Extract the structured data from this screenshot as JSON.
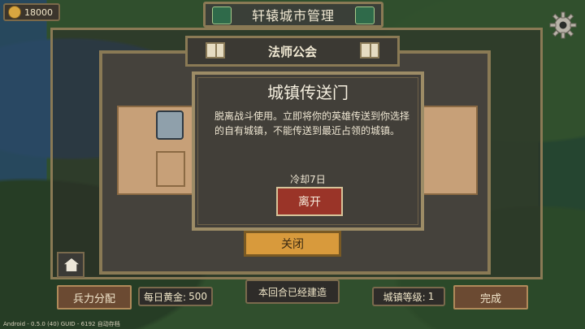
{
  "hud": {
    "gold_amount": "18000",
    "title": "轩辕城市管理",
    "settings_icon": "gear-icon"
  },
  "guild": {
    "title": "法师公会"
  },
  "dialog": {
    "title": "城镇传送门",
    "description": "脱离战斗使用。立即将你的英雄传送到你选择的自有城镇，不能传送到最近占领的城镇。",
    "cooldown": "冷却7日",
    "leave_label": "离开"
  },
  "close_label": "关闭",
  "bottom": {
    "allocate_label": "兵力分配",
    "daily_gold_label": "每日黄金:",
    "daily_gold_value": "500",
    "built_label": "本回合已经建造",
    "town_level_label": "城镇等级:",
    "town_level_value": "1",
    "done_label": "完成"
  },
  "status": {
    "platform": "Android - 0.5.0 (40)",
    "guid": "GUID - 6192",
    "autosave": "自动存档"
  },
  "colors": {
    "frame": "#8a7a55",
    "leave_button": "#9a3428",
    "close_button": "#d89a3c",
    "panel": "#423f39"
  }
}
